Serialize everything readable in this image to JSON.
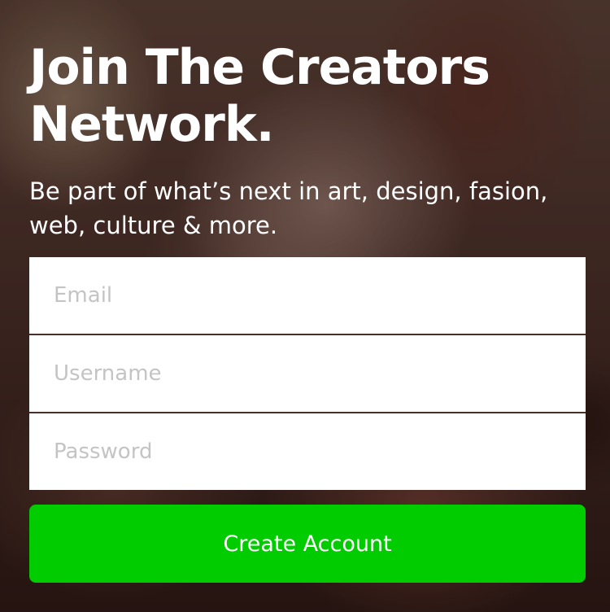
{
  "signup": {
    "headline": "Join The Creators Network.",
    "subtitle": "Be part of what’s next in art, design, fasion, web, culture & more.",
    "fields": {
      "email": {
        "placeholder": "Email",
        "value": ""
      },
      "username": {
        "placeholder": "Username",
        "value": ""
      },
      "password": {
        "placeholder": "Password",
        "value": ""
      }
    },
    "submit_label": "Create Account"
  },
  "colors": {
    "accent": "#00cc00",
    "text_on_dark": "#ffffff",
    "placeholder": "#c4c4c4",
    "field_background": "#ffffff"
  }
}
